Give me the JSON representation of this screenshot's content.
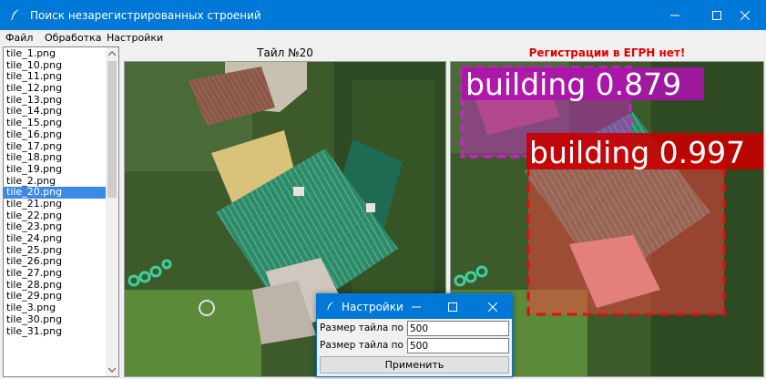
{
  "window": {
    "title": "Поиск незарегистрированных строений",
    "controls": [
      "minimize",
      "maximize",
      "close"
    ]
  },
  "menu": [
    "Файл",
    "Обработка",
    "Настройки"
  ],
  "files": [
    "tile_1.png",
    "tile_10.png",
    "tile_11.png",
    "tile_12.png",
    "tile_13.png",
    "tile_14.png",
    "tile_15.png",
    "tile_16.png",
    "tile_17.png",
    "tile_18.png",
    "tile_19.png",
    "tile_2.png",
    "tile_20.png",
    "tile_21.png",
    "tile_22.png",
    "tile_23.png",
    "tile_24.png",
    "tile_25.png",
    "tile_26.png",
    "tile_27.png",
    "tile_28.png",
    "tile_29.png",
    "tile_3.png",
    "tile_30.png",
    "tile_31.png"
  ],
  "selected_file": "tile_20.png",
  "left_panel": {
    "title": "Тайл №20"
  },
  "right_panel": {
    "title": "Регистрации в ЕГРН нет!",
    "title_color": "#e00000"
  },
  "detections": [
    {
      "label": "building 0.879",
      "color": "#d020d0"
    },
    {
      "label": "building 0.997",
      "color": "#e01010"
    }
  ],
  "dialog": {
    "title": "Настройки",
    "size_x_label": "Размер тайла по х:",
    "size_x_value": "500",
    "size_y_label": "Размер тайла по у:",
    "size_y_value": "500",
    "apply_label": "Применить"
  },
  "colors": {
    "titlebar": "#0078d7",
    "selection": "#3b8ae6"
  }
}
